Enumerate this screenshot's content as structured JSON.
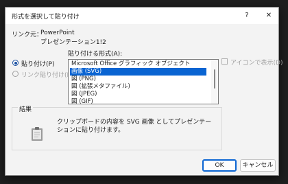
{
  "dialog": {
    "title": "形式を選択して貼り付け",
    "help_label": "?",
    "close_label": "✕"
  },
  "source": {
    "label": "リンク元：",
    "app": "PowerPoint",
    "detail": "プレゼンテーション1!2"
  },
  "format_label": "貼り付ける形式(A):",
  "paste_options": [
    {
      "label": "貼り付け(P)",
      "selected": true,
      "enabled": true
    },
    {
      "label": "リンク貼り付け(L)",
      "selected": false,
      "enabled": false
    }
  ],
  "formats": [
    {
      "label": "Microsoft Office グラフィック オブジェクト",
      "selected": false
    },
    {
      "label": "画像 (SVG)",
      "selected": true
    },
    {
      "label": "図 (PNG)",
      "selected": false
    },
    {
      "label": "図 (拡張メタファイル)",
      "selected": false
    },
    {
      "label": "図 (JPEG)",
      "selected": false
    },
    {
      "label": "図 (GIF)",
      "selected": false
    }
  ],
  "show_as_icon": {
    "label": "アイコンで表示(D)",
    "checked": false,
    "enabled": false
  },
  "result": {
    "title": "結果",
    "text": "クリップボードの内容を SVG 画像 としてプレゼンテーションに貼り付けます。",
    "icon": "clipboard-icon"
  },
  "buttons": {
    "ok": "OK",
    "cancel": "キャンセル"
  },
  "colors": {
    "accent": "#0a64d2",
    "dialog_bg": "#f3f3f3",
    "backdrop": "#1f1f1f"
  }
}
